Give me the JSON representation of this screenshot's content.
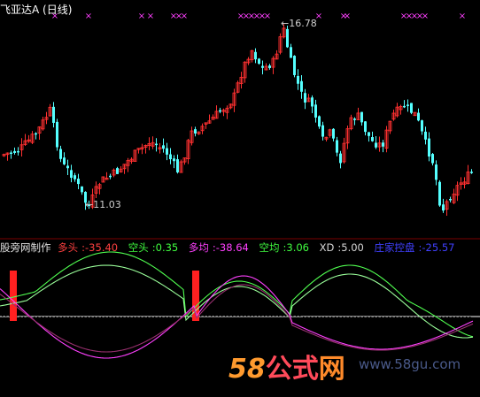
{
  "title": "飞亚达A (日线)",
  "colors": {
    "background": "#000000",
    "up_candle": "#ff3030",
    "down_candle": "#54ffff",
    "marker": "#ff40ff",
    "zero_line": "#ffffff",
    "bar_up": "#ff4040",
    "bar_down": "#6ad9ff",
    "green_line": "#50ff50",
    "magenta_line": "#ff40ff",
    "dark_line": "#9a3070"
  },
  "price_panel": {
    "high_label": "16.78",
    "low_label": "11.03",
    "marker_glyph": "×"
  },
  "indicator": {
    "name": "股旁网制作",
    "duotou": {
      "label": "多头",
      "value": "-35.40",
      "color": "#ff4040"
    },
    "kongtou": {
      "label": "空头",
      "value": "0.35",
      "color": "#40ff40"
    },
    "duojun": {
      "label": "多均",
      "value": "-38.64",
      "color": "#ff40ff"
    },
    "kongjun": {
      "label": "空均",
      "value": "3.06",
      "color": "#40ff40"
    },
    "xd": {
      "label": "XD",
      "value": "5.00",
      "color": "#d8d8d8"
    },
    "zhuangjia": {
      "label": "庄家控盘",
      "value": "-25.57",
      "color": "#4040ff"
    }
  },
  "watermark": {
    "num": "58",
    "cn1": "公式",
    "cn2": "网",
    "domain": "www.58gu.com"
  }
}
